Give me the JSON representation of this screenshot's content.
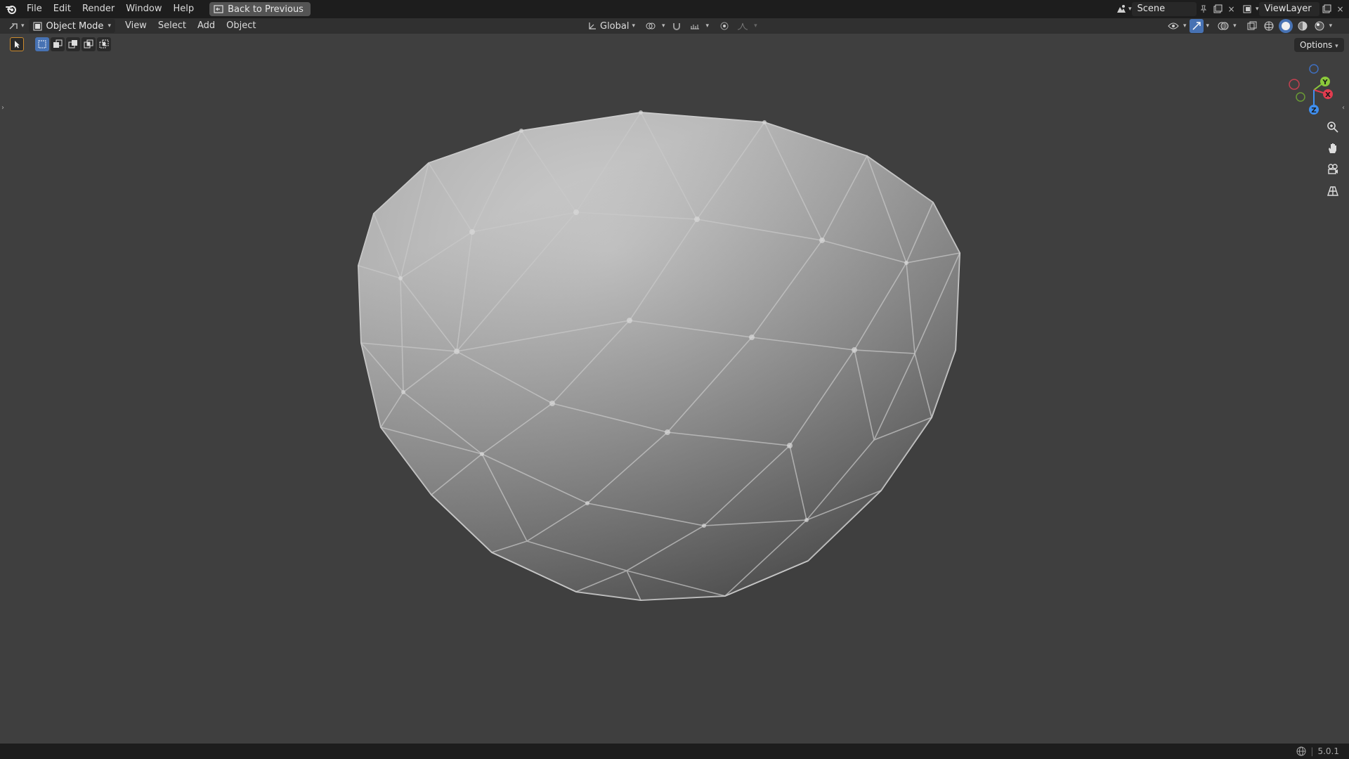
{
  "topbar": {
    "menus": [
      "File",
      "Edit",
      "Render",
      "Window",
      "Help"
    ],
    "back_label": "Back to Previous",
    "scene_name": "Scene",
    "viewlayer_name": "ViewLayer"
  },
  "header": {
    "mode": "Object Mode",
    "menus": [
      "View",
      "Select",
      "Add",
      "Object"
    ],
    "transform_orientation": "Global",
    "options_label": "Options"
  },
  "gizmo": {
    "x_label": "X",
    "y_label": "Y",
    "z_label": "Z",
    "x_color": "#e23c4f",
    "y_color": "#8bc93a",
    "z_color": "#3f8ff0"
  },
  "statusbar": {
    "version": "5.0.1"
  },
  "colors": {
    "accent": "#4772b3",
    "viewport_bg": "#3f3f3f",
    "mesh_light": "#bdbdbd",
    "mesh_dark": "#5d5d5d"
  }
}
